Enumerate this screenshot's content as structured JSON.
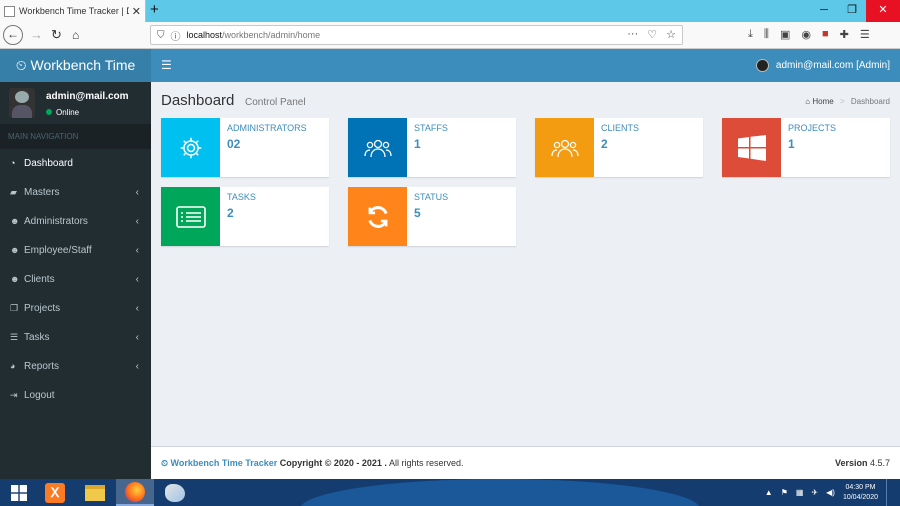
{
  "browser": {
    "tab_title": "Workbench Time Tracker | Dash",
    "new_tab": "+",
    "url_host": "localhost",
    "url_path": "/workbench/admin/home",
    "url_more": "···"
  },
  "app": {
    "logo_text": "Workbench Time",
    "header_user": "admin@mail.com [Admin]"
  },
  "sidebar": {
    "user_name": "admin@mail.com",
    "user_status": "Online",
    "nav_header": "MAIN NAVIGATION",
    "items": [
      {
        "label": "Dashboard",
        "icon": "dashboard-icon",
        "caret": false
      },
      {
        "label": "Masters",
        "icon": "book-icon",
        "caret": true
      },
      {
        "label": "Administrators",
        "icon": "user-plus-icon",
        "caret": true
      },
      {
        "label": "Employee/Staff",
        "icon": "users-icon",
        "caret": true
      },
      {
        "label": "Clients",
        "icon": "users-icon",
        "caret": true
      },
      {
        "label": "Projects",
        "icon": "copy-icon",
        "caret": true
      },
      {
        "label": "Tasks",
        "icon": "tasks-icon",
        "caret": true
      },
      {
        "label": "Reports",
        "icon": "pie-chart-icon",
        "caret": true
      },
      {
        "label": "Logout",
        "icon": "sign-out-icon",
        "caret": false
      }
    ]
  },
  "page": {
    "title": "Dashboard",
    "subtitle": "Control Panel",
    "breadcrumb_home": "Home",
    "breadcrumb_sep": ">",
    "breadcrumb_current": "Dashboard"
  },
  "boxes": [
    {
      "label": "ADMINISTRATORS",
      "value": "02",
      "color": "#00c0ef",
      "icon": "gear-icon"
    },
    {
      "label": "STAFFS",
      "value": "1",
      "color": "#0073b7",
      "icon": "users-icon"
    },
    {
      "label": "CLIENTS",
      "value": "2",
      "color": "#f39c12",
      "icon": "users-icon"
    },
    {
      "label": "PROJECTS",
      "value": "1",
      "color": "#dd4b39",
      "icon": "windows-icon"
    },
    {
      "label": "TASKS",
      "value": "2",
      "color": "#00a65a",
      "icon": "list-icon"
    },
    {
      "label": "STATUS",
      "value": "5",
      "color": "#ff851b",
      "icon": "refresh-icon"
    }
  ],
  "footer": {
    "brand": "Workbench Time Tracker",
    "copyright": " Copyright © 2020 - 2021 .",
    "rights": " All rights reserved.",
    "version_label": "Version",
    "version": "4.5.7"
  },
  "taskbar": {
    "time": "04:30 PM",
    "date": "10/04/2020"
  }
}
